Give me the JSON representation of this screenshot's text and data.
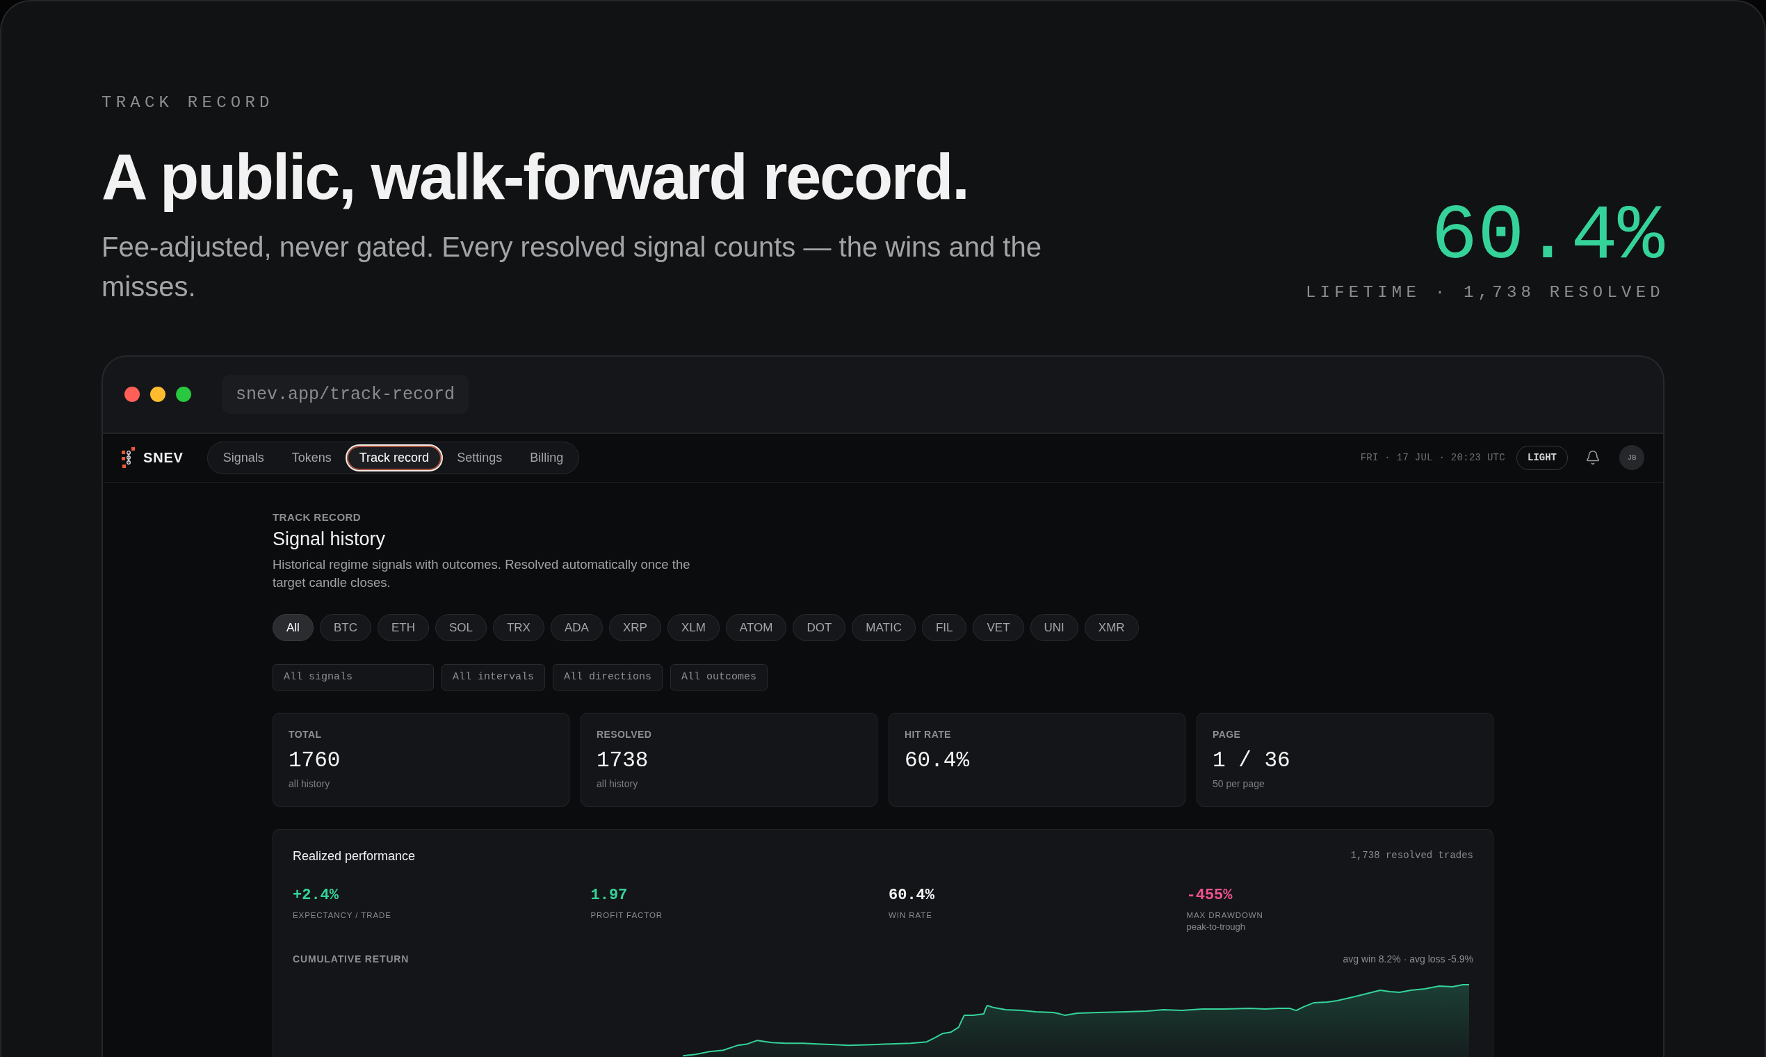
{
  "hero": {
    "eyebrow": "TRACK RECORD",
    "title": "A public, walk-forward record.",
    "subtitle": "Fee-adjusted, never gated. Every resolved signal counts — the wins and the misses.",
    "stat_value": "60.4%",
    "stat_caption": "LIFETIME · 1,738 RESOLVED"
  },
  "browser": {
    "url": "snev.app/track-record"
  },
  "app_bar": {
    "brand": "SNEV",
    "nav": [
      {
        "label": "Signals",
        "selected": false
      },
      {
        "label": "Tokens",
        "selected": false
      },
      {
        "label": "Track record",
        "selected": true
      },
      {
        "label": "Settings",
        "selected": false
      },
      {
        "label": "Billing",
        "selected": false
      }
    ],
    "clock": "FRI · 17 JUL · 20:23 UTC",
    "theme_button": "LIGHT",
    "avatar": "JB"
  },
  "page": {
    "eyebrow": "TRACK RECORD",
    "title": "Signal history",
    "description": "Historical regime signals with outcomes. Resolved automatically once the target candle closes."
  },
  "token_chips": [
    {
      "label": "All",
      "selected": true
    },
    {
      "label": "BTC",
      "selected": false
    },
    {
      "label": "ETH",
      "selected": false
    },
    {
      "label": "SOL",
      "selected": false
    },
    {
      "label": "TRX",
      "selected": false
    },
    {
      "label": "ADA",
      "selected": false
    },
    {
      "label": "XRP",
      "selected": false
    },
    {
      "label": "XLM",
      "selected": false
    },
    {
      "label": "ATOM",
      "selected": false
    },
    {
      "label": "DOT",
      "selected": false
    },
    {
      "label": "MATIC",
      "selected": false
    },
    {
      "label": "FIL",
      "selected": false
    },
    {
      "label": "VET",
      "selected": false
    },
    {
      "label": "UNI",
      "selected": false
    },
    {
      "label": "XMR",
      "selected": false
    }
  ],
  "filters": [
    {
      "value": "All signals"
    },
    {
      "value": "All intervals"
    },
    {
      "value": "All directions"
    },
    {
      "value": "All outcomes"
    }
  ],
  "stats": [
    {
      "label": "TOTAL",
      "value": "1760",
      "note": "all history"
    },
    {
      "label": "RESOLVED",
      "value": "1738",
      "note": "all history"
    },
    {
      "label": "HIT RATE",
      "value": "60.4%"
    },
    {
      "label": "PAGE",
      "value": "1 / 36",
      "note": "50 per page"
    }
  ],
  "performance": {
    "title": "Realized performance",
    "trade_count": "1,738 resolved trades",
    "metrics": [
      {
        "value": "+2.4%",
        "label": "EXPECTANCY / TRADE",
        "color": "#34d399"
      },
      {
        "value": "1.97",
        "label": "PROFIT FACTOR",
        "color": "#34d399"
      },
      {
        "value": "60.4%",
        "label": "WIN RATE",
        "color": "#f4f4f5"
      },
      {
        "value": "-455%",
        "label": "MAX DRAWDOWN",
        "note": "peak-to-trough",
        "color": "#f0528f"
      }
    ],
    "chart_title": "CUMULATIVE RETURN",
    "chart_note": "avg win 8.2% · avg loss -5.9%"
  }
}
